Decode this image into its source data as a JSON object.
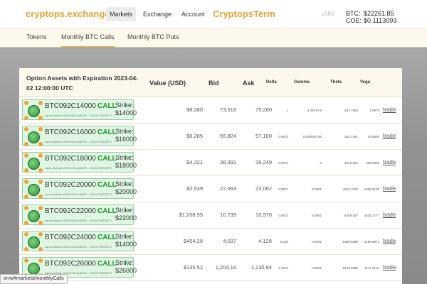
{
  "header": {
    "brand": "cryptops.exchange",
    "nav": [
      "Markets",
      "Exchange",
      "Account"
    ],
    "brand2": "CryptopsTerm",
    "version": "v585",
    "btc_label": "BTC:",
    "btc_value": "$22261.85",
    "coe_label": "COE:",
    "coe_value": "$0.1113093"
  },
  "tabs": [
    "Tokens",
    "Monthly BTC Calls",
    "Monthly BTC Puts"
  ],
  "table": {
    "title": "Option Assets with Expiration 2023-04-02 12:00:00 UTC",
    "columns": [
      "Value (USD)",
      "Bid",
      "Ask",
      "Delta",
      "Gamma",
      "Theta",
      "Vega"
    ],
    "rows": [
      {
        "name": "BTC092C14000",
        "type": "CALL",
        "strike_label": "Strike:",
        "strike": "$14000",
        "addr": "sauer:lsstrsal:-0HOhVWUlcAKE9....HOKUTHIE2BTC",
        "value": "$8,280",
        "bid": "73,518",
        "ask": "75,260",
        "delta": "1",
        "gamma": "3.3497e-8",
        "theta": "-142.7883",
        "vega": "1.5979",
        "trade": "trade"
      },
      {
        "name": "BTC092C16000",
        "type": "CALL",
        "strike_label": "Strike:",
        "strike": "$16000",
        "addr": "sauer:lsstrsal:-0HOhVWUlcAKE9....HOKUTHIE2BTC",
        "value": "$6,285",
        "bid": "55,824",
        "ask": "57,100",
        "delta": "0.9873",
        "gamma": "0.000002792",
        "theta": "-294.1461",
        "vega": "45.8858",
        "trade": "trade"
      },
      {
        "name": "BTC092C18000",
        "type": "CALL",
        "strike_label": "Strike:",
        "strike": "$18000",
        "addr": "sauer:lsstrsal:-0HOhVWUlcAKE9....HOKUTHIE2BTC",
        "value": "$4,321",
        "bid": "38,391",
        "ask": "39,249",
        "delta": "0.8674",
        "gamma": "0",
        "theta": "-1410.802",
        "vega": "458.0986",
        "trade": "trade"
      },
      {
        "name": "BTC092C20000",
        "type": "CALL",
        "strike_label": "Strike:",
        "strike": "$20000",
        "addr": "sauer:lsstrsal:-0HOhVWUlcAKE9....HOKUTHIE2BTC",
        "value": "$2,539",
        "bid": "22,564",
        "ask": "23,062",
        "delta": "0.8827",
        "gamma": "0.0001",
        "theta": "-4415.7019",
        "vega": "1565.9189",
        "trade": "trade"
      },
      {
        "name": "BTC092C22000",
        "type": "CALL",
        "strike_label": "Strike:",
        "strike": "$22000",
        "addr": "sauer:lsstrsal:-0HOhVWUlcAKE9....HOKUTHIE2BTC",
        "value": "$1,208.55",
        "bid": "10,739",
        "ask": "10,976",
        "delta": "0.5873",
        "gamma": "0.0001",
        "theta": "-5756.167",
        "vega": "2435.1777",
        "trade": "trade"
      },
      {
        "name": "BTC092C24000",
        "type": "CALL",
        "strike_label": "Strike:",
        "strike": "$14000",
        "addr": "sauer:lsstrsal:-0HOhVWUlcAKE9....HOKUTHIE2BTC",
        "value": "$454.28",
        "bid": "4,037",
        "ask": "4,126",
        "delta": "0.239",
        "gamma": "0.0001",
        "theta": "-5365.5695",
        "vega": "2180.8871",
        "trade": "trade"
      },
      {
        "name": "BTC092C26000",
        "type": "CALL",
        "strike_label": "Strike:",
        "strike": "$26000",
        "addr": "sauer:lsstrsal:-0HOhVWUlcAKE9....HOKUTHIE2BTC",
        "value": "$135.52",
        "bid": "1,204.16",
        "ask": "1,230.84",
        "delta": "0.1104",
        "gamma": "0.0001",
        "theta": "-5126.0999",
        "vega": "1177.3154",
        "trade": "trade"
      }
    ]
  },
  "status_url": "erm/#markets/monthlyCalls"
}
